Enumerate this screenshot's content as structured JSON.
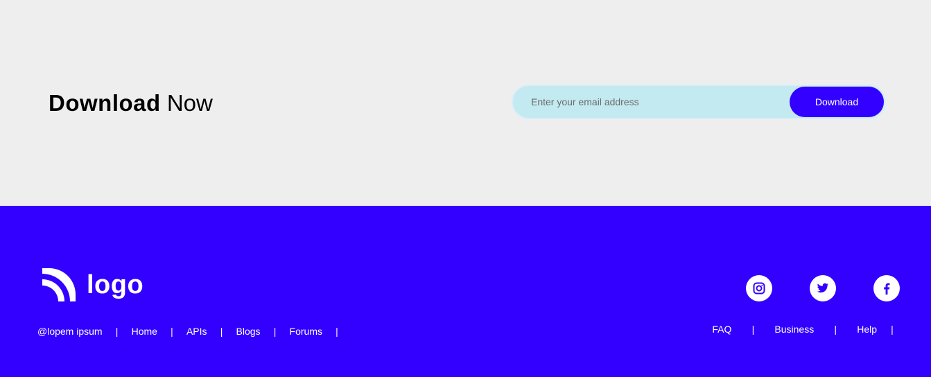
{
  "hero": {
    "title_bold": "Download",
    "title_light": "Now"
  },
  "subscribe": {
    "email_placeholder": "Enter your email address",
    "email_value": "",
    "button_label": "Download"
  },
  "footer": {
    "logo_text": "logo",
    "left_links": [
      "@lopem ipsum",
      "Home",
      "APIs",
      "Blogs",
      "Forums"
    ],
    "right_links": [
      "FAQ",
      "Business",
      "Help"
    ],
    "separator": "|",
    "socials": [
      "instagram-icon",
      "twitter-icon",
      "facebook-icon"
    ]
  },
  "colors": {
    "brand": "#3300ff",
    "page_bg": "#eeeeee",
    "input_bg": "#c3eaf0"
  }
}
